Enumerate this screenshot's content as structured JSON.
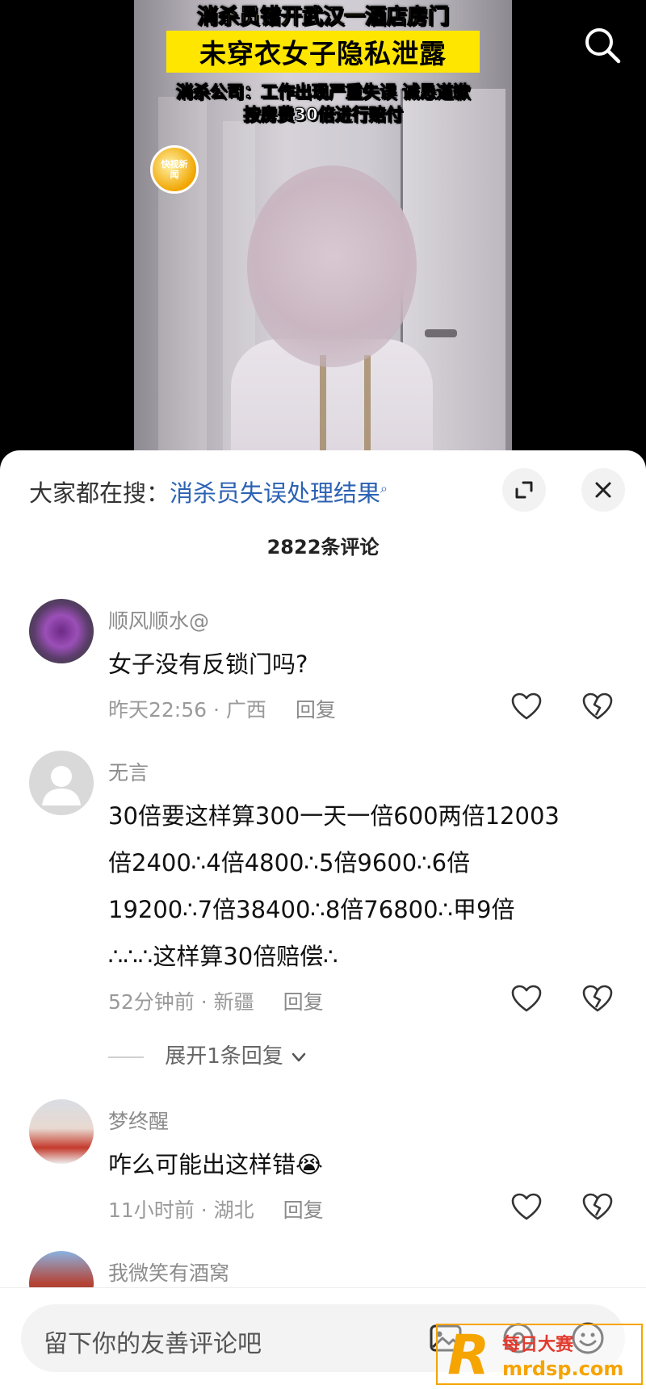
{
  "video": {
    "headline_1": "消杀员错开武汉一酒店房门",
    "headline_2": "未穿衣女子隐私泄露",
    "headline_3": "消杀公司：工作出现严重失误 诚恳道歉",
    "headline_4": "按房费30倍进行赔付",
    "logo_text": "快视新闻"
  },
  "sheet": {
    "hot_search_label": "大家都在搜：",
    "hot_search_link": "消杀员失误处理结果",
    "comment_count": "2822条评论"
  },
  "comments": [
    {
      "username": "顺风顺水@",
      "text": "女子没有反锁门吗?",
      "meta": "昨天22:56 · 广西",
      "reply": "回复"
    },
    {
      "username": "无言",
      "text_lines": [
        "30倍要这样算300一天一倍600两倍12003",
        "倍2400∴4倍4800∴5倍9600∴6倍",
        "19200∴7倍38400∴8倍76800∴甲9倍",
        "∴∴∴这样算30倍赔偿∴"
      ],
      "meta": "52分钟前 · 新疆",
      "reply": "回复",
      "expand": "展开1条回复"
    },
    {
      "username": "梦终醒",
      "text": "咋么可能出这样错",
      "emoji": "😭",
      "meta": "11小时前 · 湖北",
      "reply": "回复"
    },
    {
      "username": "我微笑有酒窝"
    }
  ],
  "input": {
    "placeholder": "留下你的友善评论吧"
  },
  "watermark": {
    "letter": "R",
    "top_text": "每日大赛",
    "bottom_text": "mrdsp.com"
  },
  "colors": {
    "link": "#2c62b3",
    "highlight": "#ffe600",
    "watermark": "#f5a400"
  }
}
